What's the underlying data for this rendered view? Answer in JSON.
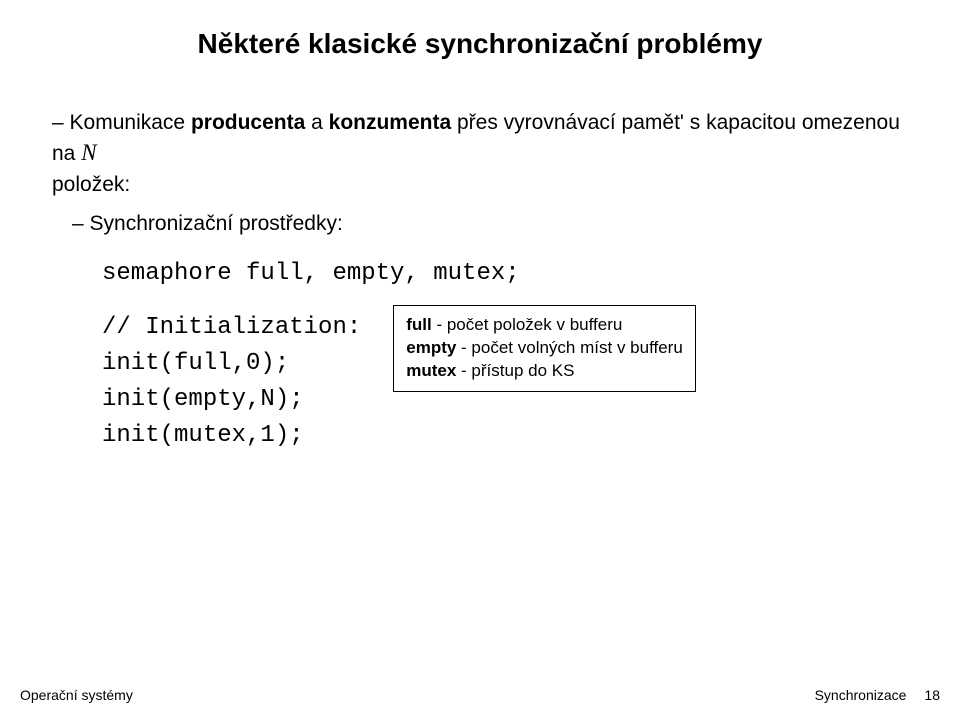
{
  "title": "Některé klasické synchronizační problémy",
  "bullet1_prefix": "–",
  "bullet1_text_a": "Komunikace ",
  "bullet1_text_b": "producenta",
  "bullet1_text_c": " a ",
  "bullet1_text_d": "konzumenta",
  "bullet1_text_e": " přes vyrovnávací pamět' s kapacitou omezenou na ",
  "bullet1_var": "N",
  "bullet1_text_f": " položek:",
  "bullet2_prefix": "–",
  "bullet2_text": "Synchronizační prostředky:",
  "code": {
    "line1": "semaphore full, empty, mutex;",
    "line2": "// Initialization:",
    "line3": "init(full,0);",
    "line4": "init(empty,N);",
    "line5": "init(mutex,1);"
  },
  "annotation": {
    "l1a": "full",
    "l1b": " - počet položek v bufferu",
    "l2a": "empty",
    "l2b": " - počet volných míst v bufferu",
    "l3a": "mutex",
    "l3b": " - přístup do KS"
  },
  "footer": {
    "left": "Operační systémy",
    "right_label": "Synchronizace",
    "page": "18"
  }
}
